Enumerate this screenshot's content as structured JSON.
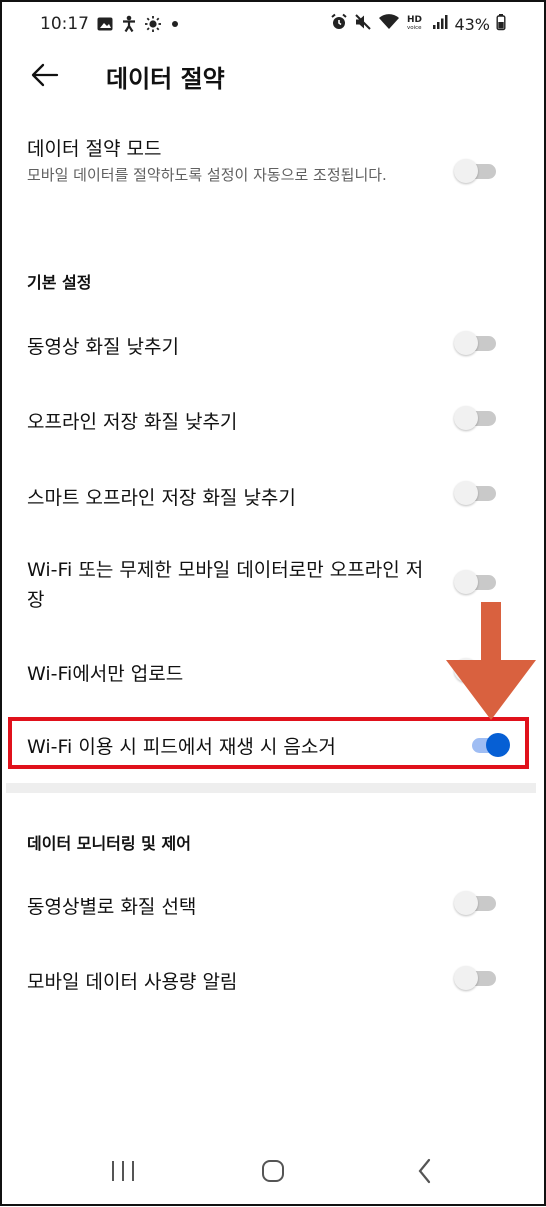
{
  "status_bar": {
    "time": "10:17",
    "left_icons": [
      "image-icon",
      "accessibility-icon",
      "brightness-icon",
      "dot-icon"
    ],
    "right_icons": [
      "alarm-icon",
      "mute-icon",
      "wifi-icon",
      "hd-voice-icon",
      "signal-icon"
    ],
    "battery": "43%"
  },
  "app_bar": {
    "title": "데이터 절약"
  },
  "settings": {
    "data_saver": {
      "title": "데이터 절약 모드",
      "subtitle": "모바일 데이터를 절약하도록 설정이 자동으로 조정됩니다.",
      "enabled": false
    },
    "basic_section": "기본 설정",
    "basic_items": [
      {
        "title": "동영상 화질 낮추기",
        "enabled": false
      },
      {
        "title": "오프라인 저장 화질 낮추기",
        "enabled": false
      },
      {
        "title": "스마트 오프라인 저장 화질 낮추기",
        "enabled": false
      },
      {
        "title": "Wi-Fi 또는 무제한 모바일 데이터로만 오프라인 저장",
        "enabled": false
      },
      {
        "title": "Wi-Fi에서만 업로드",
        "enabled": false
      },
      {
        "title": "Wi-Fi 이용 시 피드에서 재생 시 음소거",
        "enabled": true
      }
    ],
    "monitor_section": "데이터 모니터링 및 제어",
    "monitor_items": [
      {
        "title": "동영상별로 화질 선택",
        "enabled": false
      },
      {
        "title": "모바일 데이터 사용량 알림",
        "enabled": false
      }
    ]
  },
  "annotation": {
    "arrow_color": "#d9613f",
    "highlight_color": "#e0111b"
  },
  "accent_color": "#065fd4",
  "nav_bar": [
    "recents-icon",
    "home-icon",
    "back-icon"
  ]
}
